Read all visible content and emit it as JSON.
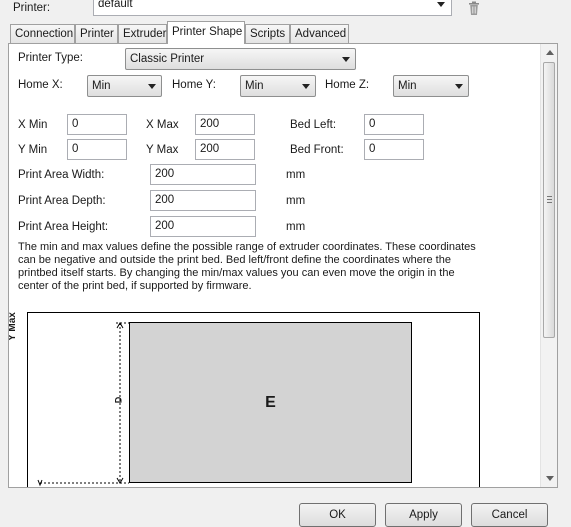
{
  "printer": {
    "label": "Printer:",
    "value": "default"
  },
  "icons": {
    "delete": "trash-icon",
    "combo_arrow": "chevron-down-icon",
    "scroll_up": "chevron-up-icon",
    "scroll_down": "chevron-down-icon"
  },
  "tabs": [
    {
      "label": "Connection"
    },
    {
      "label": "Printer"
    },
    {
      "label": "Extruder"
    },
    {
      "label": "Printer Shape",
      "active": true
    },
    {
      "label": "Scripts"
    },
    {
      "label": "Advanced"
    }
  ],
  "shape": {
    "printer_type_label": "Printer Type:",
    "printer_type_value": "Classic Printer",
    "home_x_label": "Home X:",
    "home_x_value": "Min",
    "home_y_label": "Home Y:",
    "home_y_value": "Min",
    "home_z_label": "Home Z:",
    "home_z_value": "Min",
    "x_min_label": "X Min",
    "x_min_value": "0",
    "x_max_label": "X Max",
    "x_max_value": "200",
    "bed_left_label": "Bed Left:",
    "bed_left_value": "0",
    "y_min_label": "Y Min",
    "y_min_value": "0",
    "y_max_label": "Y Max",
    "y_max_value": "200",
    "bed_front_label": "Bed Front:",
    "bed_front_value": "0",
    "width_label": "Print Area Width:",
    "width_value": "200",
    "width_unit": "mm",
    "depth_label": "Print Area Depth:",
    "depth_value": "200",
    "depth_unit": "mm",
    "height_label": "Print Area Height:",
    "height_value": "200",
    "height_unit": "mm",
    "description_lines": [
      "The min and max values define the possible range of extruder coordinates. These coordinates",
      "can be negative and outside the print bed. Bed left/front define the coordinates where the",
      "printbed itself starts. By changing the min/max values you can even move the origin in the",
      "center of the print bed, if supported by firmware."
    ]
  },
  "diagram": {
    "y_axis_label": "Y Max",
    "dimension_label": "D",
    "bed_label": "E"
  },
  "footer": {
    "ok": "OK",
    "apply": "Apply",
    "cancel": "Cancel"
  },
  "colors": {
    "bed_fill": "#d3d3d3",
    "window_bg": "#f0f0f0"
  }
}
